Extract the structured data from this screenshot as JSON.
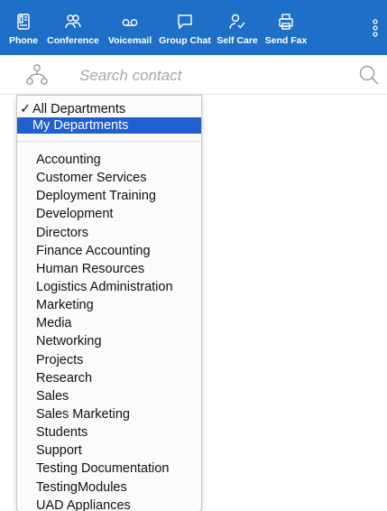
{
  "toolbar": {
    "items": [
      {
        "label": "Phone",
        "icon": "phone-icon"
      },
      {
        "label": "Conference",
        "icon": "conference-icon"
      },
      {
        "label": "Voicemail",
        "icon": "voicemail-icon"
      },
      {
        "label": "Group Chat",
        "icon": "chat-bubble-icon"
      },
      {
        "label": "Self Care",
        "icon": "self-care-icon"
      },
      {
        "label": "Send Fax",
        "icon": "fax-icon"
      }
    ],
    "more_icon": "vertical-dots-icon",
    "bg_color": "#1e6fc8"
  },
  "search": {
    "placeholder": "Search contact",
    "value": ""
  },
  "dropdown": {
    "top_options": [
      {
        "label": "All Departments",
        "checked": true,
        "selected": false
      },
      {
        "label": "My Departments",
        "checked": false,
        "selected": true
      }
    ],
    "departments": [
      "Accounting",
      "Customer Services",
      "Deployment  Training",
      "Development",
      "Directors",
      "Finance  Accounting",
      "Human Resources",
      "Logistics  Administration",
      "Marketing",
      "Media",
      "Networking",
      "Projects",
      "Research",
      "Sales",
      "Sales  Marketing",
      "Students",
      "Support",
      "Testing  Documentation",
      "TestingModules",
      "UAD  Appliances"
    ],
    "selected_color": "#1f5fd0"
  }
}
